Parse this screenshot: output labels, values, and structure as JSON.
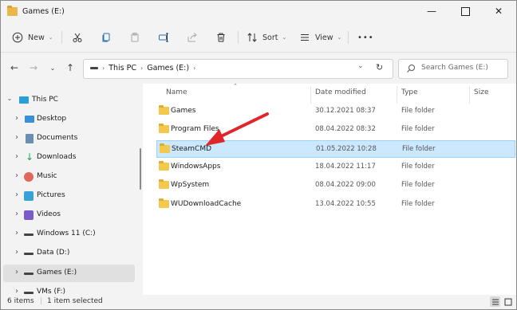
{
  "window": {
    "title": "Games (E:)"
  },
  "toolbar": {
    "new_label": "New",
    "sort_label": "Sort",
    "view_label": "View",
    "more_label": "•••"
  },
  "address": {
    "crumbs": [
      "This PC",
      "Games (E:)"
    ],
    "search_placeholder": "Search Games (E:)"
  },
  "sidebar": {
    "items": [
      {
        "label": "This PC",
        "icon": "monitor-icon"
      },
      {
        "label": "Desktop",
        "icon": "desktop-icon"
      },
      {
        "label": "Documents",
        "icon": "documents-icon"
      },
      {
        "label": "Downloads",
        "icon": "download-icon"
      },
      {
        "label": "Music",
        "icon": "music-icon"
      },
      {
        "label": "Pictures",
        "icon": "pictures-icon"
      },
      {
        "label": "Videos",
        "icon": "videos-icon"
      },
      {
        "label": "Windows 11 (C:)",
        "icon": "drive-icon"
      },
      {
        "label": "Data (D:)",
        "icon": "drive-icon"
      },
      {
        "label": "Games (E:)",
        "icon": "drive-icon",
        "selected": true
      },
      {
        "label": "VMs (F:)",
        "icon": "drive-icon"
      }
    ]
  },
  "columns": {
    "name": "Name",
    "date": "Date modified",
    "type": "Type",
    "size": "Size"
  },
  "files": [
    {
      "name": "Games",
      "date": "30.12.2021 08:37",
      "type": "File folder"
    },
    {
      "name": "Program Files",
      "date": "08.04.2022 08:32",
      "type": "File folder"
    },
    {
      "name": "SteamCMD",
      "date": "01.05.2022 10:28",
      "type": "File folder",
      "selected": true
    },
    {
      "name": "WindowsApps",
      "date": "18.04.2022 11:17",
      "type": "File folder"
    },
    {
      "name": "WpSystem",
      "date": "08.04.2022 09:00",
      "type": "File folder"
    },
    {
      "name": "WUDownloadCache",
      "date": "13.04.2022 10:55",
      "type": "File folder"
    }
  ],
  "status": {
    "items_count": "6 items",
    "selected_count": "1 item selected"
  },
  "colors": {
    "accent": "#0078d4",
    "selection": "#cce8ff",
    "folder": "#f2c94c",
    "annotation_arrow": "#e0252b"
  }
}
